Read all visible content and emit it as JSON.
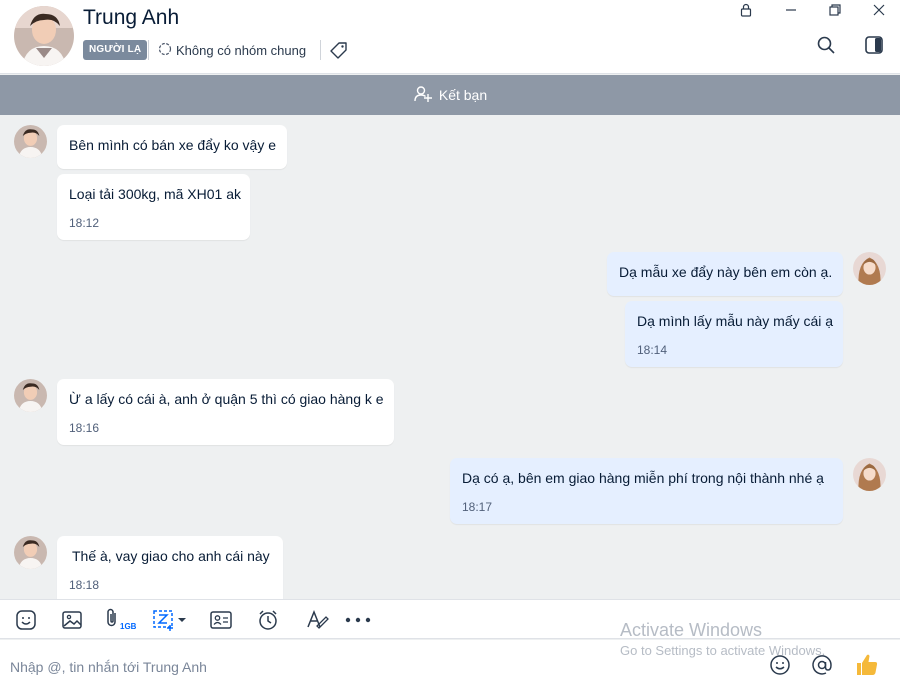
{
  "header": {
    "contact_name": "Trung Anh",
    "badge": "NGƯỜI LẠ",
    "group_info": "Không có nhóm chung"
  },
  "friend_bar": {
    "label": "Kết bạn"
  },
  "messages": [
    {
      "side": "in",
      "text": "Bên mình có bán xe đẩy ko vậy e",
      "time": ""
    },
    {
      "side": "in",
      "text": "Loại tải 300kg, mã XH01 ak",
      "time": "18:12"
    },
    {
      "side": "out",
      "text": "Dạ mẫu xe đẩy này bên em còn ạ.",
      "time": ""
    },
    {
      "side": "out",
      "text": "Dạ mình lấy mẫu này mấy cái ạ",
      "time": "18:14"
    },
    {
      "side": "in",
      "text": "Ừ a lấy có cái à, anh ở quận 5 thì có giao hàng k e",
      "time": "18:16"
    },
    {
      "side": "out",
      "text": "Dạ có ạ, bên em giao hàng miễn phí trong nội thành nhé ạ",
      "time": "18:17"
    },
    {
      "side": "in",
      "text": "Thế à, vay giao cho anh cái này",
      "time": "18:18"
    }
  ],
  "toolbar": {
    "attach_size_label": "1GB"
  },
  "composer": {
    "placeholder": "Nhập @, tin nhắn tới Trung Anh"
  },
  "watermark": {
    "line1": "Activate Windows",
    "line2": "Go to Settings to activate Windows."
  },
  "colors": {
    "incoming_bubble": "#ffffff",
    "outgoing_bubble": "#e5efff",
    "friend_bar": "#8e98a6",
    "background": "#eef0f1",
    "like_thumb": "#f5b93a"
  },
  "icons": [
    "lock-icon",
    "minimize-icon",
    "restore-icon",
    "close-icon",
    "search-icon",
    "sidebar-toggle-icon",
    "add-friend-icon",
    "tag-icon",
    "group-icon",
    "sticker-icon",
    "image-icon",
    "attachment-icon",
    "screenshot-icon",
    "contact-card-icon",
    "reminder-icon",
    "format-text-icon",
    "more-icon",
    "emoji-icon",
    "mention-icon",
    "like-icon"
  ]
}
